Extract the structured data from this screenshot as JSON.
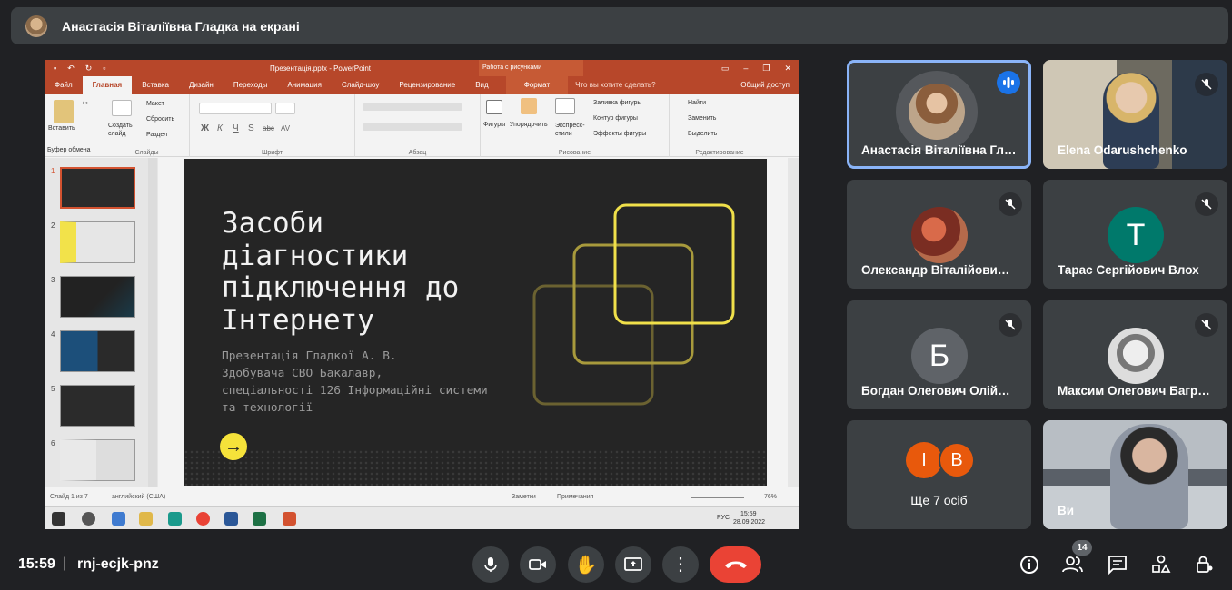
{
  "banner": {
    "text": "Анастасія Віталіївна Гладка на екрані"
  },
  "powerpoint": {
    "window_title": "Презентація.pptx - PowerPoint",
    "context_tab": "Работа с рисунками",
    "tabs": [
      "Файл",
      "Главная",
      "Вставка",
      "Дизайн",
      "Переходы",
      "Анимация",
      "Слайд-шоу",
      "Рецензирование",
      "Вид"
    ],
    "format_tab": "Формат",
    "tell_me": "Что вы хотите сделать?",
    "share": "Общий доступ",
    "ribbon": {
      "paste": "Вставить",
      "clipboard": "Буфер обмена",
      "new_slide": "Создать слайд",
      "layout": "Макет",
      "reset": "Сбросить",
      "section": "Раздел",
      "slides": "Слайды",
      "font": "Шрифт",
      "font_buttons": [
        "Ж",
        "К",
        "Ч",
        "S",
        "abc",
        "AV"
      ],
      "paragraph": "Абзац",
      "shapes": "Фигуры",
      "arrange": "Упорядочить",
      "quick_styles": "Экспресс-стили",
      "shape_fill": "Заливка фигуры",
      "shape_outline": "Контур фигуры",
      "shape_effects": "Эффекты фигуры",
      "drawing": "Рисование",
      "find": "Найти",
      "replace": "Заменить",
      "select": "Выделить",
      "editing": "Редактирование"
    },
    "thumbnails": [
      {
        "num": "1",
        "text": "Засоби діагностики підключення до Інтернету"
      },
      {
        "num": "2",
        "text": "Діагностика підключення до мережі Інтернет"
      },
      {
        "num": "3",
        "text": "Що є зв'язок з Інтернетом?"
      },
      {
        "num": "4",
        "text": "Дії перевірки"
      },
      {
        "num": "5",
        "text": "Загальні проблеми підключення"
      },
      {
        "num": "6",
        "text": "Вирішення проблем із підключенням до Інтернету"
      }
    ],
    "slide": {
      "title": "Засоби\nдіагностики\nпідключення до\nІнтернету",
      "subtitle": "Презентація Гладкої А. В.\nЗдобувача СВО Бакалавр,\nспеціальності 126 Інформаційні системи\nта технології"
    },
    "status": {
      "slide_of": "Слайд 1 из 7",
      "language": "английский (США)",
      "notes": "Заметки",
      "comments": "Примечания",
      "zoom": "76%"
    },
    "taskbar": {
      "lang": "РУС",
      "time": "15:59",
      "date": "28.09.2022"
    }
  },
  "participants": [
    {
      "name": "Анастасія Віталіївна Гладка",
      "display": "Анастасія Віталіївна Гл…",
      "speaking": true
    },
    {
      "name": "Elena Odarushchenko",
      "muted": true
    },
    {
      "name": "Олександр Віталійович",
      "display": "Олександр Віталійови…",
      "muted": true
    },
    {
      "name": "Тарас Сергійович Влох",
      "initial": "T",
      "color": "#00796b",
      "muted": true
    },
    {
      "name": "Богдан Олегович Олій",
      "display": "Богдан Олегович Олій…",
      "initial": "Б",
      "color": "#5f6368",
      "muted": true
    },
    {
      "name": "Максим Олегович Багр",
      "display": "Максим Олегович Багр…",
      "muted": true
    },
    {
      "more_label": "Ще 7 осіб",
      "initials": [
        "І",
        "В"
      ],
      "color": "#e8590c"
    },
    {
      "name": "Ви"
    }
  ],
  "meeting": {
    "time": "15:59",
    "separator": "|",
    "code": "rnj-ecjk-pnz",
    "people_count": "14"
  },
  "colors": {
    "accent": "#8ab4f8",
    "end_call": "#ea4335",
    "ppt": "#b7472a"
  }
}
